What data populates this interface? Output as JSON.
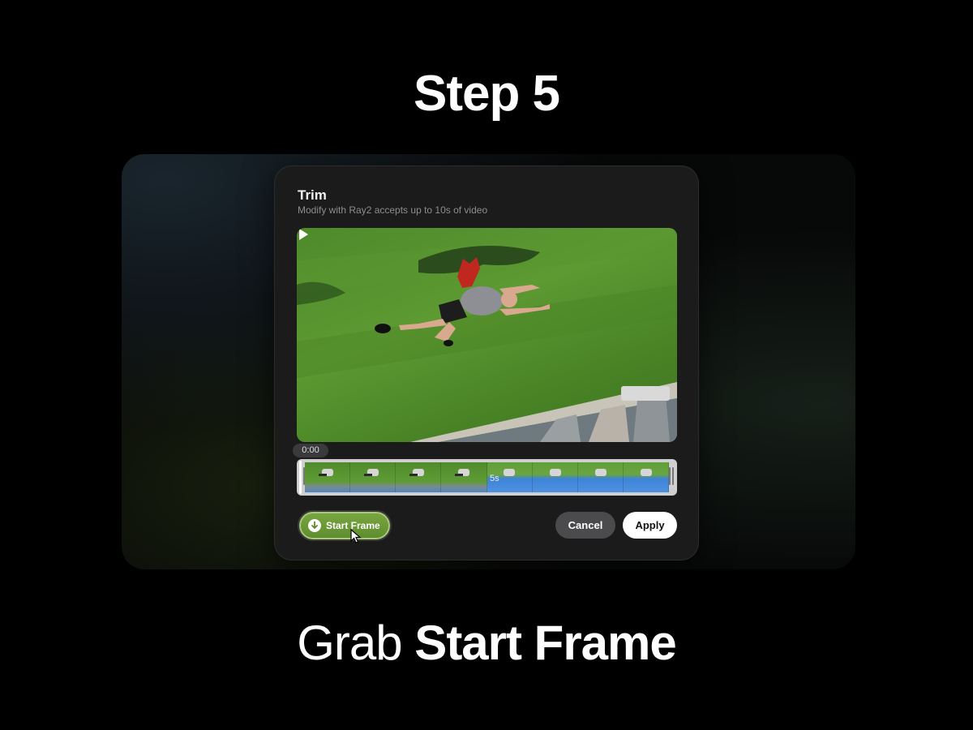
{
  "heading": "Step 5",
  "dialog": {
    "title": "Trim",
    "subtitle": "Modify with Ray2 accepts up to 10s of video",
    "current_time": "0:00",
    "timeline_marker_label": "5s",
    "start_frame_button": "Start Frame",
    "cancel_button": "Cancel",
    "apply_button": "Apply"
  },
  "caption": {
    "prefix": "Grab",
    "emphasis": "Start Frame"
  },
  "icons": [
    "play-icon",
    "download-icon",
    "cursor-icon"
  ],
  "colors": {
    "background": "#000000",
    "dialog": "#1b1b1c",
    "apply": "#ffffff",
    "cancel": "#4b4b4d",
    "grass": "#5d9a32"
  }
}
